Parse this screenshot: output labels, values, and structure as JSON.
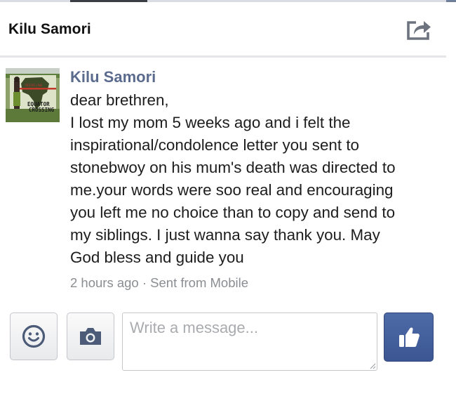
{
  "header": {
    "title": "Kilu Samori",
    "share_icon": "share-icon"
  },
  "message": {
    "sender": "Kilu Samori",
    "avatar_sign_lines": [
      "EQUATOR",
      "CROSSING"
    ],
    "lines": [
      "dear brethren,",
      "I lost my mom 5 weeks ago and i felt the",
      "inspirational/condolence letter you sent to",
      "stonebwoy on his mum's death was directed to",
      "me.your words were soo real and encouraging",
      "you left me no choice than to copy and send to",
      "my siblings. I just wanna say thank you. May",
      "God bless and guide you"
    ],
    "time": "2 hours ago",
    "separator": "·",
    "source": "Sent from Mobile"
  },
  "composer": {
    "emoji_icon": "smiley-icon",
    "camera_icon": "camera-icon",
    "placeholder": "Write a message...",
    "like_icon": "thumbs-up-icon"
  },
  "colors": {
    "sender_name": "#5b6b8e",
    "like_button": "#3b5693",
    "meta_text": "#8a8d91"
  }
}
